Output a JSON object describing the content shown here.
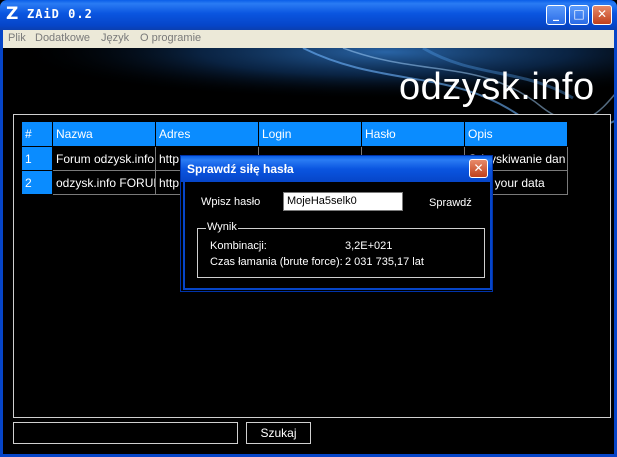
{
  "window": {
    "logo": "Z",
    "title": "ZAiD 0.2",
    "buttons": {
      "minimize": "_",
      "maximize": "□",
      "close": "✕"
    }
  },
  "menu": [
    "Plik",
    "Dodatkowe",
    "Język",
    "O programie"
  ],
  "brand": "odzysk.info",
  "table": {
    "headers": [
      "#",
      "Nazwa",
      "Adres",
      "Login",
      "Hasło",
      "Opis"
    ],
    "rows": [
      [
        "1",
        "Forum odzysk.info",
        "http",
        "",
        "",
        "Odzyskiwanie dan"
      ],
      [
        "2",
        "odzysk.info FORUM",
        "http",
        "",
        "",
        "over your data"
      ]
    ]
  },
  "search": {
    "value": "",
    "button": "Szukaj"
  },
  "dialog": {
    "title": "Sprawdź siłę hasła",
    "close": "✕",
    "password_label": "Wpisz hasło",
    "password_value": "MojeHa5selk0",
    "check_button": "Sprawdź",
    "result_label": "Wynik",
    "combinations_label": "Kombinacji:",
    "combinations_value": "3,2E+021",
    "time_label": "Czas łamania (brute force):",
    "time_value": "2 031 735,17 lat"
  },
  "colors": {
    "header_blue": "#0a8cff",
    "titlebar_blue": "#0645c8",
    "close_red": "#c0401c"
  }
}
